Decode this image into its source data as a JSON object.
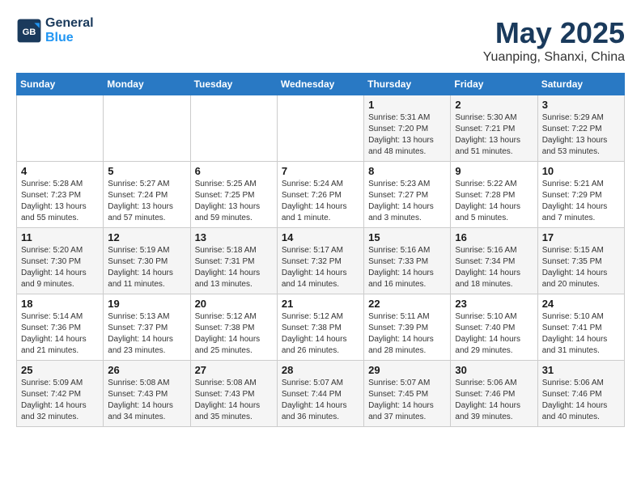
{
  "logo": {
    "line1": "General",
    "line2": "Blue"
  },
  "title": "May 2025",
  "subtitle": "Yuanping, Shanxi, China",
  "days_of_week": [
    "Sunday",
    "Monday",
    "Tuesday",
    "Wednesday",
    "Thursday",
    "Friday",
    "Saturday"
  ],
  "weeks": [
    [
      {
        "day": "",
        "info": ""
      },
      {
        "day": "",
        "info": ""
      },
      {
        "day": "",
        "info": ""
      },
      {
        "day": "",
        "info": ""
      },
      {
        "day": "1",
        "info": "Sunrise: 5:31 AM\nSunset: 7:20 PM\nDaylight: 13 hours\nand 48 minutes."
      },
      {
        "day": "2",
        "info": "Sunrise: 5:30 AM\nSunset: 7:21 PM\nDaylight: 13 hours\nand 51 minutes."
      },
      {
        "day": "3",
        "info": "Sunrise: 5:29 AM\nSunset: 7:22 PM\nDaylight: 13 hours\nand 53 minutes."
      }
    ],
    [
      {
        "day": "4",
        "info": "Sunrise: 5:28 AM\nSunset: 7:23 PM\nDaylight: 13 hours\nand 55 minutes."
      },
      {
        "day": "5",
        "info": "Sunrise: 5:27 AM\nSunset: 7:24 PM\nDaylight: 13 hours\nand 57 minutes."
      },
      {
        "day": "6",
        "info": "Sunrise: 5:25 AM\nSunset: 7:25 PM\nDaylight: 13 hours\nand 59 minutes."
      },
      {
        "day": "7",
        "info": "Sunrise: 5:24 AM\nSunset: 7:26 PM\nDaylight: 14 hours\nand 1 minute."
      },
      {
        "day": "8",
        "info": "Sunrise: 5:23 AM\nSunset: 7:27 PM\nDaylight: 14 hours\nand 3 minutes."
      },
      {
        "day": "9",
        "info": "Sunrise: 5:22 AM\nSunset: 7:28 PM\nDaylight: 14 hours\nand 5 minutes."
      },
      {
        "day": "10",
        "info": "Sunrise: 5:21 AM\nSunset: 7:29 PM\nDaylight: 14 hours\nand 7 minutes."
      }
    ],
    [
      {
        "day": "11",
        "info": "Sunrise: 5:20 AM\nSunset: 7:30 PM\nDaylight: 14 hours\nand 9 minutes."
      },
      {
        "day": "12",
        "info": "Sunrise: 5:19 AM\nSunset: 7:30 PM\nDaylight: 14 hours\nand 11 minutes."
      },
      {
        "day": "13",
        "info": "Sunrise: 5:18 AM\nSunset: 7:31 PM\nDaylight: 14 hours\nand 13 minutes."
      },
      {
        "day": "14",
        "info": "Sunrise: 5:17 AM\nSunset: 7:32 PM\nDaylight: 14 hours\nand 14 minutes."
      },
      {
        "day": "15",
        "info": "Sunrise: 5:16 AM\nSunset: 7:33 PM\nDaylight: 14 hours\nand 16 minutes."
      },
      {
        "day": "16",
        "info": "Sunrise: 5:16 AM\nSunset: 7:34 PM\nDaylight: 14 hours\nand 18 minutes."
      },
      {
        "day": "17",
        "info": "Sunrise: 5:15 AM\nSunset: 7:35 PM\nDaylight: 14 hours\nand 20 minutes."
      }
    ],
    [
      {
        "day": "18",
        "info": "Sunrise: 5:14 AM\nSunset: 7:36 PM\nDaylight: 14 hours\nand 21 minutes."
      },
      {
        "day": "19",
        "info": "Sunrise: 5:13 AM\nSunset: 7:37 PM\nDaylight: 14 hours\nand 23 minutes."
      },
      {
        "day": "20",
        "info": "Sunrise: 5:12 AM\nSunset: 7:38 PM\nDaylight: 14 hours\nand 25 minutes."
      },
      {
        "day": "21",
        "info": "Sunrise: 5:12 AM\nSunset: 7:38 PM\nDaylight: 14 hours\nand 26 minutes."
      },
      {
        "day": "22",
        "info": "Sunrise: 5:11 AM\nSunset: 7:39 PM\nDaylight: 14 hours\nand 28 minutes."
      },
      {
        "day": "23",
        "info": "Sunrise: 5:10 AM\nSunset: 7:40 PM\nDaylight: 14 hours\nand 29 minutes."
      },
      {
        "day": "24",
        "info": "Sunrise: 5:10 AM\nSunset: 7:41 PM\nDaylight: 14 hours\nand 31 minutes."
      }
    ],
    [
      {
        "day": "25",
        "info": "Sunrise: 5:09 AM\nSunset: 7:42 PM\nDaylight: 14 hours\nand 32 minutes."
      },
      {
        "day": "26",
        "info": "Sunrise: 5:08 AM\nSunset: 7:43 PM\nDaylight: 14 hours\nand 34 minutes."
      },
      {
        "day": "27",
        "info": "Sunrise: 5:08 AM\nSunset: 7:43 PM\nDaylight: 14 hours\nand 35 minutes."
      },
      {
        "day": "28",
        "info": "Sunrise: 5:07 AM\nSunset: 7:44 PM\nDaylight: 14 hours\nand 36 minutes."
      },
      {
        "day": "29",
        "info": "Sunrise: 5:07 AM\nSunset: 7:45 PM\nDaylight: 14 hours\nand 37 minutes."
      },
      {
        "day": "30",
        "info": "Sunrise: 5:06 AM\nSunset: 7:46 PM\nDaylight: 14 hours\nand 39 minutes."
      },
      {
        "day": "31",
        "info": "Sunrise: 5:06 AM\nSunset: 7:46 PM\nDaylight: 14 hours\nand 40 minutes."
      }
    ]
  ]
}
